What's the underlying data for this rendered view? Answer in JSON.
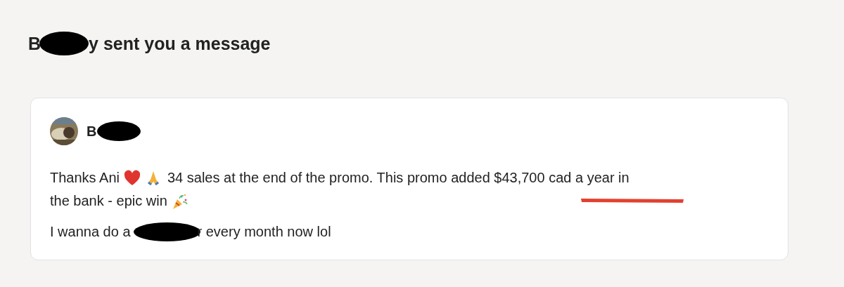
{
  "heading": [
    {
      "kind": "text",
      "text": "B"
    },
    {
      "kind": "redaction"
    },
    {
      "kind": "text",
      "text": "y sent you a message"
    }
  ],
  "message": {
    "sender": [
      {
        "kind": "text",
        "text": "B"
      },
      {
        "kind": "redaction"
      }
    ],
    "paragraphs": [
      {
        "lines": [
          [
            {
              "kind": "text",
              "text": "Thanks Ani"
            },
            {
              "kind": "heart"
            },
            {
              "kind": "hands"
            },
            {
              "kind": "text",
              "text": "34 sales at the end of the promo. This promo added $43,700 cad a year in"
            }
          ],
          [
            {
              "kind": "text",
              "text": "the bank - epic win"
            },
            {
              "kind": "party"
            }
          ]
        ]
      },
      {
        "lines": [
          [
            {
              "kind": "text",
              "text": "I wanna do a"
            },
            {
              "kind": "redaction"
            },
            {
              "kind": "text",
              "text": "r every month now lol"
            }
          ]
        ]
      }
    ]
  }
}
